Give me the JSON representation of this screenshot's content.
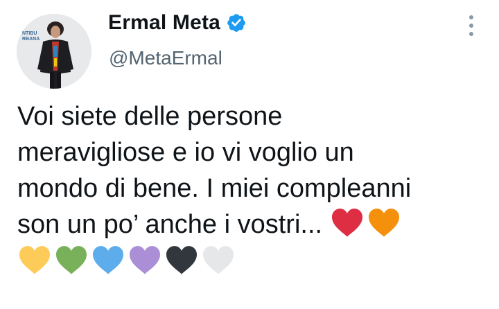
{
  "author": {
    "display_name": "Ermal Meta",
    "handle": "@MetaErmal",
    "verified": true,
    "avatar_text": "NTIBU RBANA"
  },
  "tweet": {
    "lines": [
      "Voi siete delle persone",
      "meravigliose e io vi voglio un",
      "mondo di bene. I miei compleanni",
      "son un po’ anche i vostri..."
    ],
    "hearts_inline": [
      {
        "name": "red-heart-icon",
        "color": "#dd2e44"
      },
      {
        "name": "orange-heart-icon",
        "color": "#f4900c"
      }
    ],
    "hearts_row": [
      {
        "name": "yellow-heart-icon",
        "color": "#fdcb58"
      },
      {
        "name": "green-heart-icon",
        "color": "#78b159"
      },
      {
        "name": "blue-heart-icon",
        "color": "#5dadec"
      },
      {
        "name": "purple-heart-icon",
        "color": "#aa8ed6"
      },
      {
        "name": "black-heart-icon",
        "color": "#31373d"
      },
      {
        "name": "white-heart-icon",
        "color": "#e6e7e8"
      }
    ]
  },
  "colors": {
    "text": "#0f1419",
    "secondary": "#536471",
    "verified_badge": "#1d9bf0",
    "more_dots": "#8b98a5"
  },
  "icons": {
    "verified": "verified-badge-icon",
    "more": "more-options-icon"
  }
}
